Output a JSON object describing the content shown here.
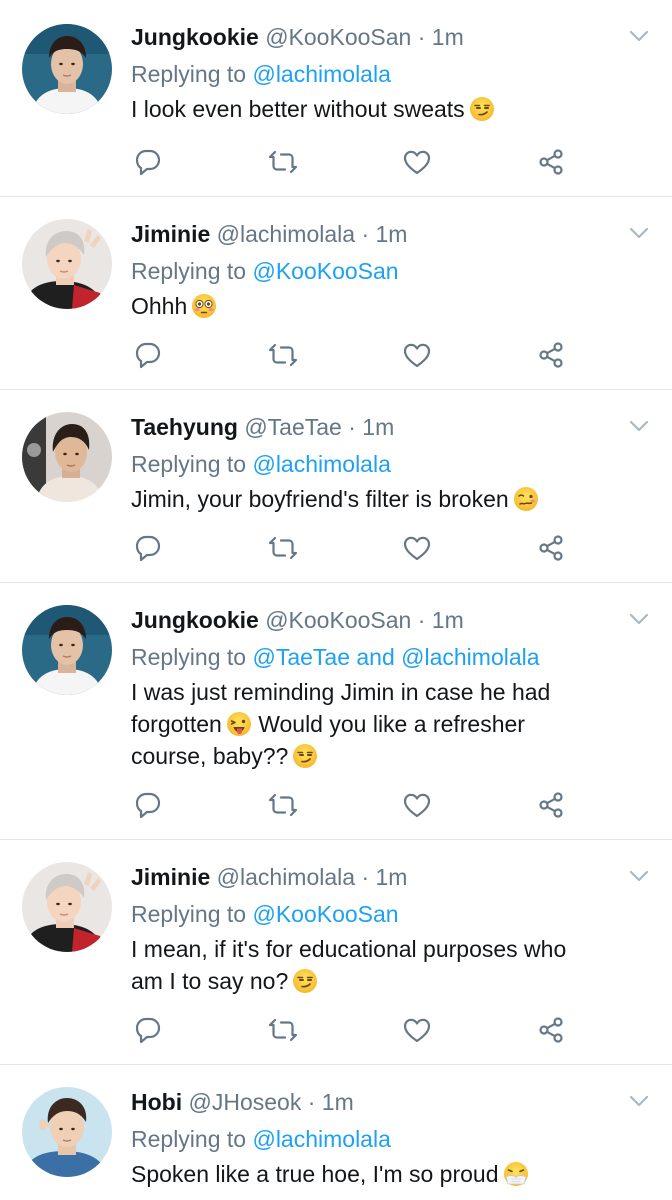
{
  "tweets": [
    {
      "name": "Jungkookie",
      "handle": "@KooKooSan",
      "dot": "·",
      "time": "1m",
      "replying_prefix": "Replying to",
      "replying_to": "@lachimolala",
      "text": "I look even better without sweats",
      "emoji": "smirk-emoji",
      "avatar": "avatar-jungkookie"
    },
    {
      "name": "Jiminie",
      "handle": "@lachimolala",
      "dot": "·",
      "time": "1m",
      "replying_prefix": "Replying to",
      "replying_to": "@KooKooSan",
      "text": "Ohhh",
      "emoji": "flushed-emoji",
      "avatar": "avatar-jiminie"
    },
    {
      "name": "Taehyung",
      "handle": "@TaeTae",
      "dot": "·",
      "time": "1m",
      "replying_prefix": "Replying to",
      "replying_to": "@lachimolala",
      "text": "Jimin, your boyfriend's filter is broken",
      "emoji": "woozy-emoji",
      "avatar": "avatar-taehyung"
    },
    {
      "name": "Jungkookie",
      "handle": "@KooKooSan",
      "dot": "·",
      "time": "1m",
      "replying_prefix": "Replying to",
      "replying_to": "@TaeTae and @lachimolala",
      "text_line1": "I was just reminding Jimin in case he had",
      "text_line2a": "forgotten",
      "text_line2b": "Would you like a refresher",
      "text_line3": "course, baby??",
      "emoji": "smirk-emoji",
      "avatar": "avatar-jungkookie"
    },
    {
      "name": "Jiminie",
      "handle": "@lachimolala",
      "dot": "·",
      "time": "1m",
      "replying_prefix": "Replying to",
      "replying_to": "@KooKooSan",
      "text_line1": "I mean, if it's for educational purposes who",
      "text_line2": "am I to say no?",
      "emoji": "smirk-emoji",
      "avatar": "avatar-jiminie"
    },
    {
      "name": "Hobi",
      "handle": "@JHoseok",
      "dot": "·",
      "time": "1m",
      "replying_prefix": "Replying to",
      "replying_to": "@lachimolala",
      "text": "Spoken like a true hoe, I'm so proud",
      "emoji": "sneezing-emoji",
      "avatar": "avatar-hobi"
    }
  ],
  "colors": {
    "link": "#1da1f2",
    "secondary": "#657786",
    "primary": "#14171a",
    "divider": "#e1e8ed"
  },
  "icons": [
    "reply-icon",
    "retweet-icon",
    "like-icon",
    "share-icon",
    "chevron-down-icon"
  ]
}
